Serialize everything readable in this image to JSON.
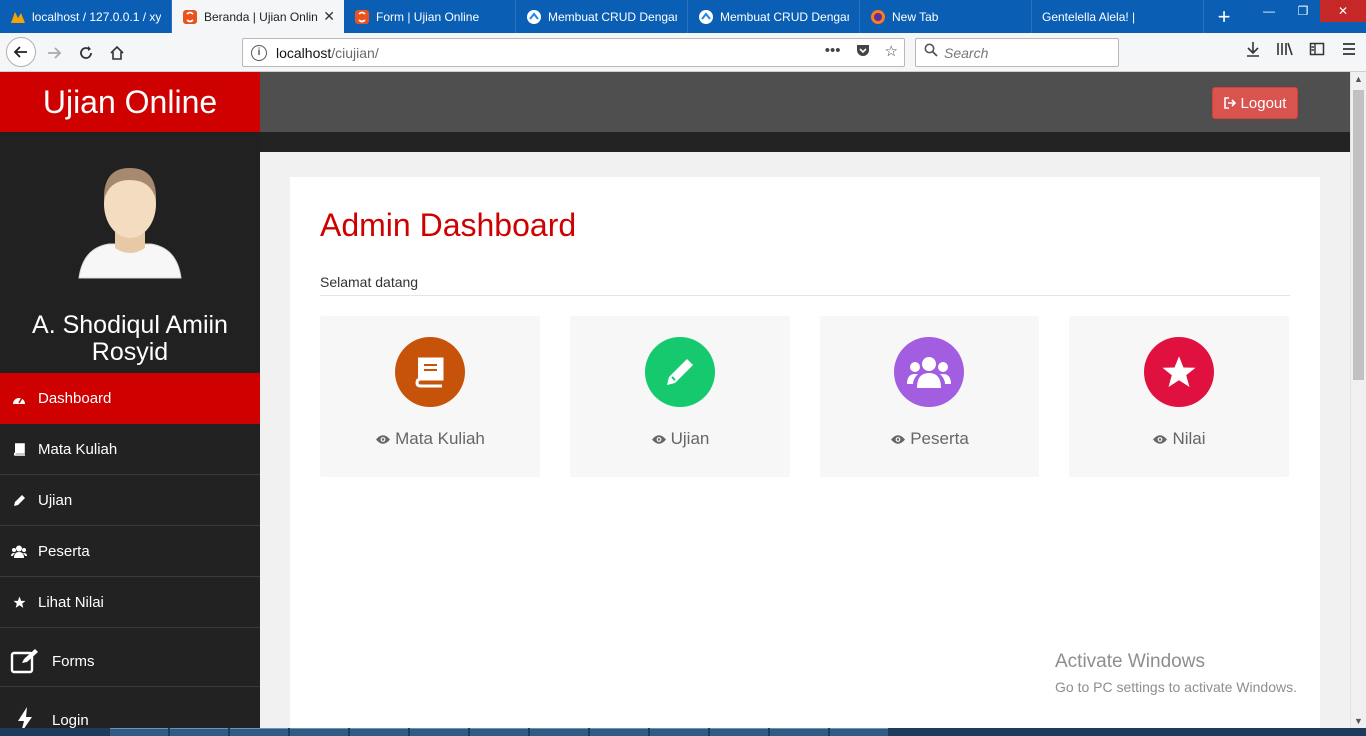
{
  "browser": {
    "tabs": [
      {
        "title": "localhost / 127.0.0.1 / xy",
        "icon": "phpmyadmin-icon",
        "active": false
      },
      {
        "title": "Beranda | Ujian Onlin",
        "icon": "codeigniter-icon",
        "active": true
      },
      {
        "title": "Form | Ujian Online",
        "icon": "codeigniter-icon",
        "active": false
      },
      {
        "title": "Membuat CRUD Dengan",
        "icon": "site-icon",
        "active": false
      },
      {
        "title": "Membuat CRUD Dengan",
        "icon": "site-icon",
        "active": false
      },
      {
        "title": "New Tab",
        "icon": "firefox-icon",
        "active": false
      },
      {
        "title": "Gentelella Alela! |",
        "icon": "",
        "active": false
      }
    ],
    "url_host": "localhost",
    "url_path": "/ciujian/",
    "search_placeholder": "Search"
  },
  "app": {
    "brand": "Ujian Online",
    "user_name": "A. Shodiqul Amiin Rosyid",
    "logout_label": "Logout",
    "menu": [
      {
        "label": "Dashboard",
        "icon": "dashboard-icon",
        "active": true
      },
      {
        "label": "Mata Kuliah",
        "icon": "book-icon",
        "active": false
      },
      {
        "label": "Ujian",
        "icon": "pencil-icon",
        "active": false
      },
      {
        "label": "Peserta",
        "icon": "users-icon",
        "active": false
      },
      {
        "label": "Lihat Nilai",
        "icon": "star-icon",
        "active": false
      },
      {
        "label": "Forms",
        "icon": "edit-icon",
        "active": false
      },
      {
        "label": "Login",
        "icon": "bolt-icon",
        "active": false
      }
    ],
    "title": "Admin Dashboard",
    "subtitle": "Selamat datang",
    "cards": [
      {
        "label": "Mata Kuliah",
        "icon": "book-icon",
        "color": "#c65309"
      },
      {
        "label": "Ujian",
        "icon": "pencil-icon",
        "color": "#16c96f"
      },
      {
        "label": "Peserta",
        "icon": "users-icon",
        "color": "#a25de0"
      },
      {
        "label": "Nilai",
        "icon": "star-icon",
        "color": "#e0103f"
      }
    ]
  },
  "watermark": {
    "line1": "Activate Windows",
    "line2": "Go to PC settings to activate Windows."
  },
  "colors": {
    "brand_red": "#cf0000",
    "tab_strip": "#0a5fb4",
    "logout": "#d9534f"
  }
}
